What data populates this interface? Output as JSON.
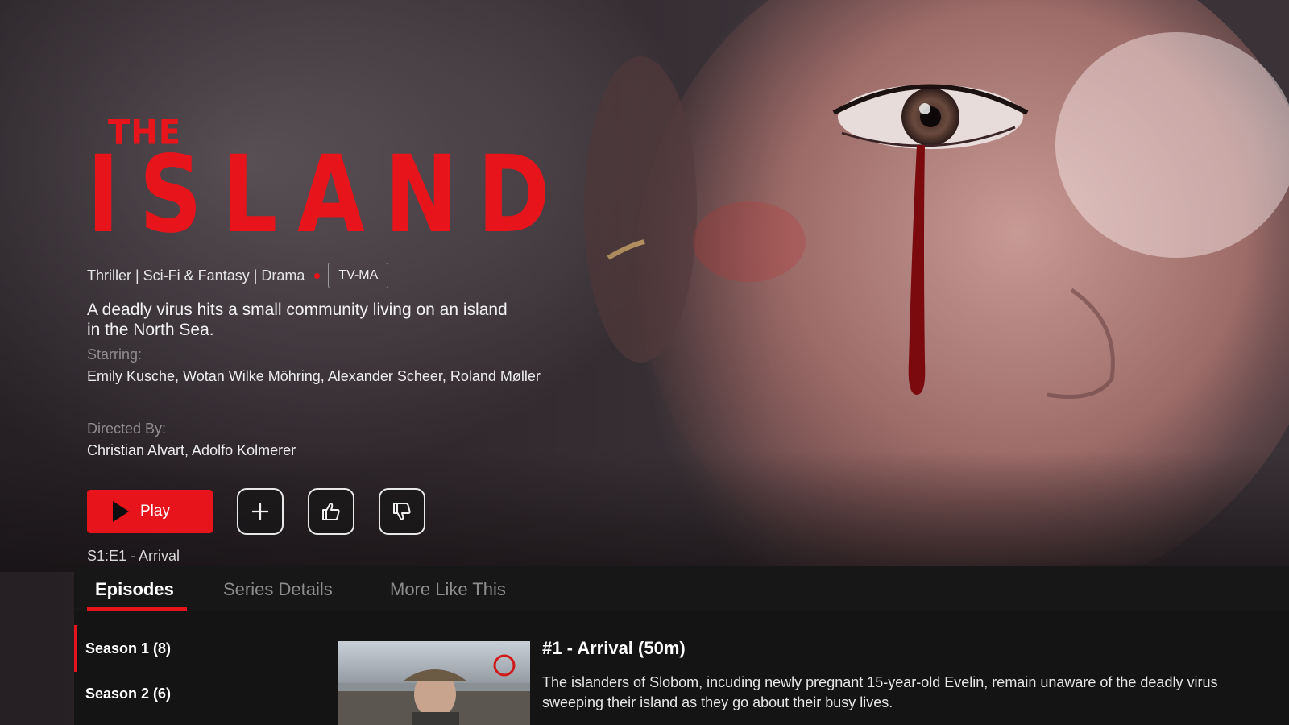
{
  "show": {
    "logo_top": "THE",
    "logo_main": "ISLAND",
    "genres": "Thriller | Sci-Fi & Fantasy | Drama",
    "rating": "TV-MA",
    "synopsis": "A deadly virus hits a small community living on an island in the North Sea.",
    "starring_label": "Starring:",
    "starring": "Emily Kusche, Wotan Wilke Möhring, Alexander Scheer, Roland Møller",
    "directed_label": "Directed By:",
    "directed": "Christian Alvart, Adolfo Kolmerer"
  },
  "actions": {
    "play_label": "Play",
    "add_icon": "plus-icon",
    "like_icon": "thumbs-up-icon",
    "dislike_icon": "thumbs-down-icon",
    "current_episode": "S1:E1 - Arrival"
  },
  "tabs": [
    {
      "label": "Episodes",
      "active": true
    },
    {
      "label": "Series Details",
      "active": false
    },
    {
      "label": "More Like This",
      "active": false
    }
  ],
  "seasons": [
    {
      "label": "Season 1 (8)",
      "selected": true
    },
    {
      "label": "Season 2 (6)",
      "selected": false
    }
  ],
  "episode": {
    "title": "#1 - Arrival (50m)",
    "description": "The islanders of Slobom, incuding newly pregnant 15-year-old Evelin, remain unaware of the deadly virus sweeping their island as they go about their busy lives."
  },
  "colors": {
    "accent": "#e8141b",
    "panel": "#141414"
  }
}
